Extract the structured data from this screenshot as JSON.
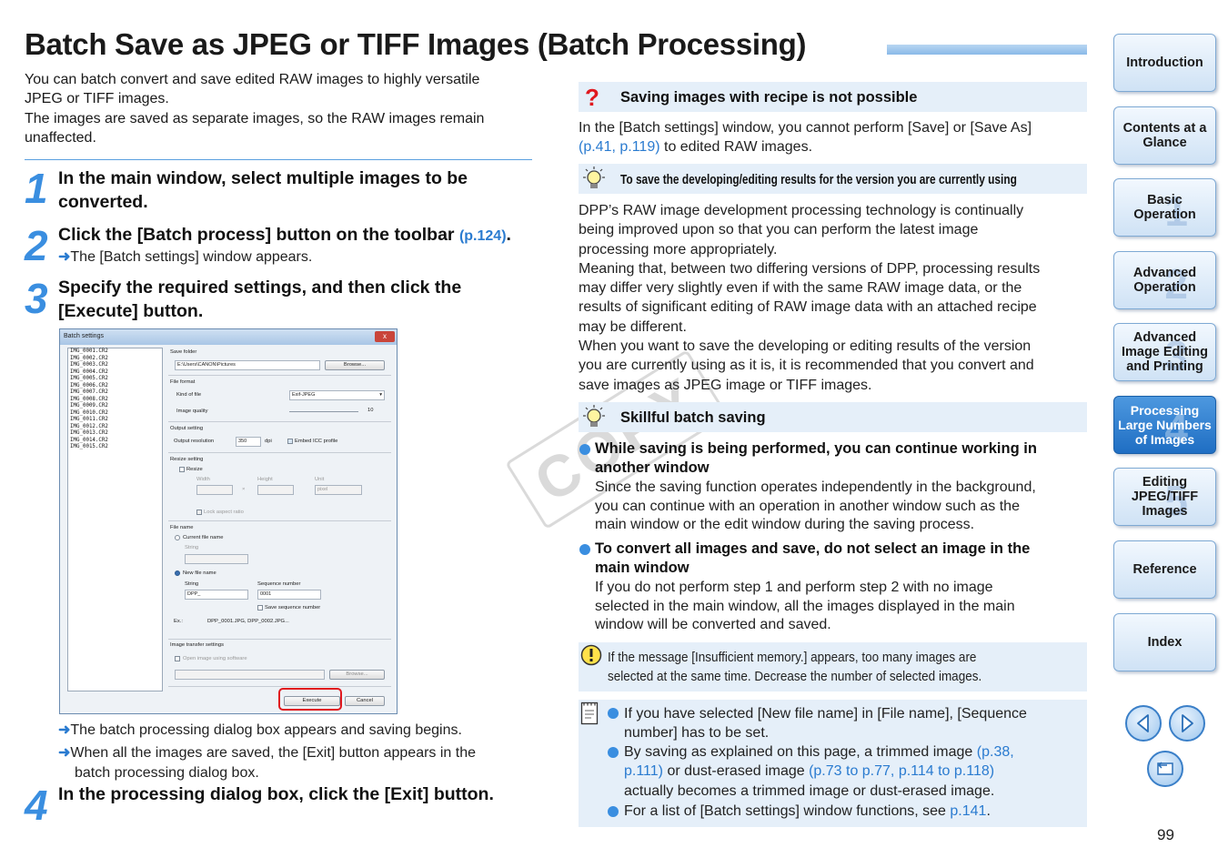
{
  "page": {
    "title": "Batch Save as JPEG or TIFF Images (Batch Processing)",
    "intro_lines": [
      "You can batch convert and save edited RAW images to highly versatile",
      "JPEG or TIFF images.",
      "The images are saved as separate images, so the RAW images remain",
      "unaffected."
    ],
    "page_number": "99"
  },
  "steps": [
    {
      "num": "1",
      "title_lines": [
        "In the main window, select multiple images to be",
        "converted."
      ]
    },
    {
      "num": "2",
      "title": "Click the [Batch process] button on the toolbar ",
      "ref": "(p.124)",
      "tail": ".",
      "note": "The [Batch settings] window appears."
    },
    {
      "num": "3",
      "title_lines": [
        "Specify the required settings, and then click the",
        "[Execute] button."
      ],
      "notes": [
        "The batch processing dialog box appears and saving begins.",
        "When all the images are saved, the [Exit] button appears in the",
        "batch processing dialog box."
      ]
    },
    {
      "num": "4",
      "title": "In the processing dialog box, click the [Exit] button."
    }
  ],
  "dialog": {
    "title": "Batch settings",
    "close": "x",
    "files": [
      "IMG_0001.CR2",
      "IMG_0002.CR2",
      "IMG_0003.CR2",
      "IMG_0004.CR2",
      "IMG_0005.CR2",
      "IMG_0006.CR2",
      "IMG_0007.CR2",
      "IMG_0008.CR2",
      "IMG_0009.CR2",
      "IMG_0010.CR2",
      "IMG_0011.CR2",
      "IMG_0012.CR2",
      "IMG_0013.CR2",
      "IMG_0014.CR2",
      "IMG_0015.CR2"
    ],
    "save_folder_label": "Save folder",
    "save_folder_value": "E:\\Users\\CANON\\Pictures",
    "browse": "Browse...",
    "file_format_label": "File format",
    "kind_of_file_label": "Kind of file",
    "kind_of_file_value": "Exif-JPEG",
    "image_quality_label": "Image quality",
    "image_quality_value": "10",
    "output_setting_label": "Output setting",
    "output_resolution_label": "Output resolution",
    "output_resolution_value": "350",
    "dpi": "dpi",
    "embed_icc": "Embed ICC profile",
    "resize_setting_label": "Resize setting",
    "resize": "Resize",
    "width": "Width",
    "height": "Height",
    "unit": "Unit",
    "unit_value": "pixel",
    "times": "×",
    "lock_aspect": "Lock aspect ratio",
    "file_name_label": "File name",
    "current_file_name": "Current file name",
    "string_label": "String",
    "new_file_name": "New file name",
    "sequence_number_label": "Sequence number",
    "string_value": "DPP_",
    "sequence_value": "0001",
    "save_sequence": "Save sequence number",
    "example_label": "Ex.:",
    "example_value": "DPP_0001.JPG, DPP_0002.JPG...",
    "image_transfer_label": "Image transfer settings",
    "open_image_software": "Open image using software",
    "execute": "Execute",
    "cancel": "Cancel"
  },
  "right": {
    "box1_title": "Saving images with recipe is not possible",
    "box1_text_a": "In the [Batch settings] window, you cannot perform [Save] or [Save As]",
    "box1_ref": "(p.41, p.119)",
    "box1_text_b": " to edited RAW images.",
    "box2_title": "To save the developing/editing results for the version you are currently using",
    "box2_lines": [
      "DPP’s RAW image development processing technology is continually",
      "being improved upon so that you can perform the latest image",
      "processing more appropriately.",
      "Meaning that, between two differing versions of DPP, processing results",
      "may differ very slightly even if with the same RAW image data, or the",
      "results of significant editing of RAW image data with an attached recipe",
      "may be different.",
      "When you want to save the developing or editing results of the version",
      "you are currently using as it is, it is recommended that you convert and",
      "save images as JPEG image or TIFF images."
    ],
    "box3_title": "Skillful batch saving",
    "bullet1_head": [
      "While saving is being performed, you can continue working in",
      "another window"
    ],
    "bullet1_body": [
      "Since the saving function operates independently in the background,",
      "you can continue with an operation in another window such as the",
      "main window or the edit window during the saving process."
    ],
    "bullet2_head": [
      "To convert all images and save, do not select an image in the",
      "main window"
    ],
    "bullet2_body": [
      "If you do not perform step 1 and perform step 2 with no image",
      "selected in the main window, all the images displayed in the main",
      "window will be converted and saved."
    ],
    "caution_lines": [
      "If the message [Insufficient memory.] appears, too many images are",
      "selected at the same time. Decrease the number of selected images."
    ],
    "memo1": [
      "If you have selected [New file name] in [File name], [Sequence",
      "number] has to be set."
    ],
    "memo2_a": "By saving as explained on this page, a trimmed image ",
    "memo2_ref1": "(p.38,",
    "memo2_ref1b": "p.111)",
    "memo2_b": " or dust-erased image ",
    "memo2_ref2": "(p.73 to p.77, p.114 to p.118)",
    "memo2_c": "actually becomes a trimmed image or dust-erased image.",
    "memo3_a": "For a list of [Batch settings] window functions, see ",
    "memo3_ref": "p.141",
    "memo3_b": "."
  },
  "watermark": "COPY",
  "nav": [
    {
      "label": "Introduction",
      "num": "",
      "active": false
    },
    {
      "label": "Contents at a Glance",
      "num": "",
      "active": false
    },
    {
      "label": "Basic Operation",
      "num": "1",
      "active": false
    },
    {
      "label": "Advanced Operation",
      "num": "2",
      "active": false
    },
    {
      "label": "Advanced Image Editing and Printing",
      "num": "3",
      "active": false
    },
    {
      "label": "Processing Large Numbers of Images",
      "num": "4",
      "active": true
    },
    {
      "label": "Editing JPEG/TIFF Images",
      "num": "5",
      "active": false
    },
    {
      "label": "Reference",
      "num": "",
      "active": false
    },
    {
      "label": "Index",
      "num": "",
      "active": false
    }
  ],
  "colors": {
    "accent": "#3a8ee0",
    "link": "#2a7bd0",
    "box_bg": "#e5eff9",
    "nav_active": "#1f6ec3",
    "alert_red": "#e0181e"
  }
}
